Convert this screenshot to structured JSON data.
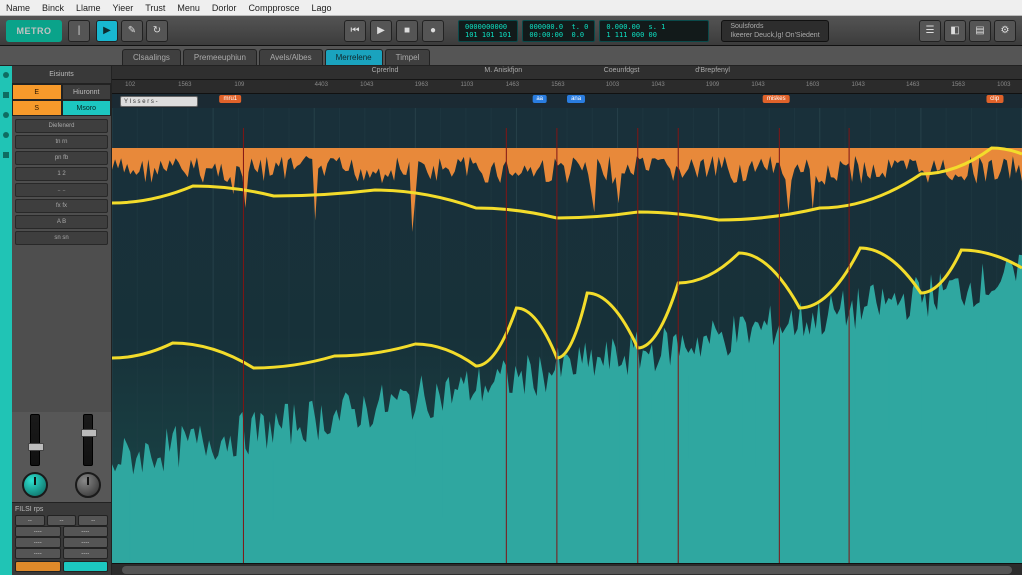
{
  "menubar": [
    "Name",
    "Binck",
    "Llame",
    "Yieer",
    "Trust",
    "Menu",
    "Dorlor",
    "Compprosce",
    "Lago"
  ],
  "logo": "METRO",
  "toolbar_buttons": [
    {
      "name": "tool-pointer",
      "glyph": "▶",
      "active": true
    },
    {
      "name": "tool-pencil",
      "glyph": "✎",
      "active": false
    },
    {
      "name": "tool-loop",
      "glyph": "↻",
      "active": false
    }
  ],
  "transport": [
    {
      "name": "transport-rewind",
      "glyph": "⏮"
    },
    {
      "name": "transport-play",
      "glyph": "▶"
    },
    {
      "name": "transport-stop",
      "glyph": "■"
    },
    {
      "name": "transport-record",
      "glyph": "●"
    }
  ],
  "timecode": {
    "box1": "0000000000\n101 101 101",
    "box2": "000000.0  t. 0\n00:00:00  0.0",
    "box3": "0.000.00  s. 1\n1 111 000 00"
  },
  "display_box": {
    "line1": "Soulsfords",
    "line2": "Ikeerer  Deuck,lg!   On'Siedent"
  },
  "right_icons": [
    {
      "name": "view-mixer-icon",
      "glyph": "☰"
    },
    {
      "name": "view-editor-icon",
      "glyph": "◧"
    },
    {
      "name": "view-browser-icon",
      "glyph": "▤"
    },
    {
      "name": "settings-icon",
      "glyph": "⚙"
    }
  ],
  "tabs": [
    {
      "label": "Clsaalings",
      "active": false
    },
    {
      "label": "Premeeuphiun",
      "active": false
    },
    {
      "label": "Avels/Albes",
      "active": false
    },
    {
      "label": "Merrelene",
      "active": true
    },
    {
      "label": "Timpel",
      "active": false
    }
  ],
  "panel": {
    "title": "Eisiunts",
    "sub_tabs": [
      {
        "label": "S",
        "cls": "a"
      },
      {
        "label": "Msoro",
        "cls": "b"
      }
    ],
    "selector_a": "E",
    "selector_b": "Hiuronnt",
    "slots": [
      "Diefenerd",
      "tn  rn",
      "pn  fb",
      "1   2",
      "..  ..",
      "fx  fx",
      "A   B",
      "sn  sn"
    ],
    "faders": [
      {
        "pos": 28
      },
      {
        "pos": 14
      }
    ],
    "knobs": [
      {
        "accent": true
      },
      {
        "accent": false
      }
    ],
    "foot_label": "FILSI rps",
    "foot_rows": [
      [
        "--",
        "--",
        "--"
      ],
      [
        "----",
        "----"
      ],
      [
        "----",
        "----"
      ],
      [
        "----",
        "----"
      ]
    ],
    "chips": [
      {
        "label": "",
        "cls": "or"
      },
      {
        "label": "",
        "cls": "tl"
      }
    ]
  },
  "markers": [
    {
      "pct": 30,
      "label": "Cprerlnd"
    },
    {
      "pct": 43,
      "label": "M. Aniskfjon"
    },
    {
      "pct": 56,
      "label": "Coeunfdgst"
    },
    {
      "pct": 66,
      "label": "d'Brepfenyl"
    }
  ],
  "ruler_ticks": [
    {
      "pct": 2,
      "label": "102"
    },
    {
      "pct": 8,
      "label": "1563"
    },
    {
      "pct": 14,
      "label": "109"
    },
    {
      "pct": 23,
      "label": "4403"
    },
    {
      "pct": 28,
      "label": "1043"
    },
    {
      "pct": 34,
      "label": "1963"
    },
    {
      "pct": 39,
      "label": "1103"
    },
    {
      "pct": 44,
      "label": "1463"
    },
    {
      "pct": 49,
      "label": "1563"
    },
    {
      "pct": 55,
      "label": "1003"
    },
    {
      "pct": 60,
      "label": "1043"
    },
    {
      "pct": 66,
      "label": "1909"
    },
    {
      "pct": 71,
      "label": "1043"
    },
    {
      "pct": 77,
      "label": "1603"
    },
    {
      "pct": 82,
      "label": "1043"
    },
    {
      "pct": 88,
      "label": "1463"
    },
    {
      "pct": 93,
      "label": "1563"
    },
    {
      "pct": 98,
      "label": "1003"
    }
  ],
  "region_labels": [
    {
      "pct": 13,
      "cls": "or",
      "label": "mru1"
    },
    {
      "pct": 47,
      "cls": "bl",
      "label": "aa"
    },
    {
      "pct": 51,
      "cls": "bl",
      "label": "ana"
    },
    {
      "pct": 73,
      "cls": "or",
      "label": "miskes"
    },
    {
      "pct": 97,
      "cls": "or",
      "label": "clip"
    }
  ],
  "dropdown": "Y I s s e r s -"
}
